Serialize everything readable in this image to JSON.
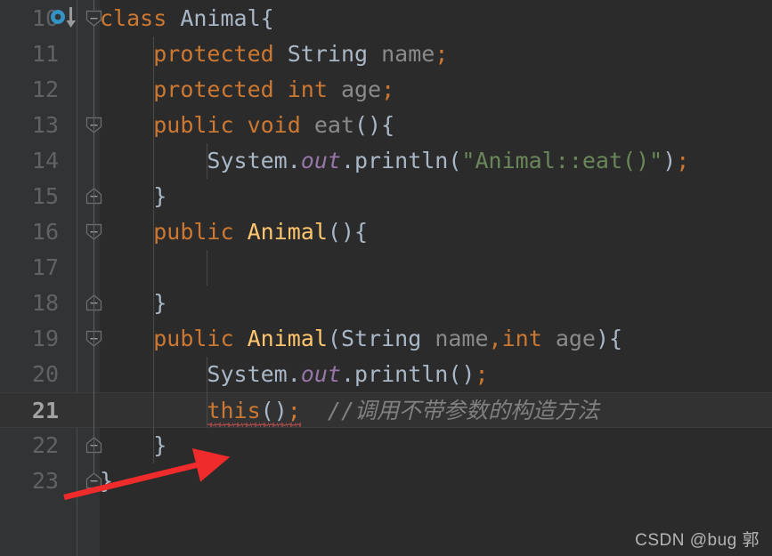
{
  "editor": {
    "theme": "darcula",
    "background": "#2b2b2b",
    "gutter_background": "#313335",
    "current_line_background": "#323232",
    "current_line_number": "21"
  },
  "colors": {
    "keyword": "#cc7832",
    "class_name": "#a9b7c6",
    "constructor_name": "#ffc66d",
    "string_literal": "#6a8759",
    "static_field": "#9876aa",
    "identifier": "#8a8a8a",
    "comment": "#808080",
    "line_number": "#606366",
    "error_squiggle": "#d25252",
    "gutter_icon_blue": "#3592c4",
    "annotation_arrow": "#ef2b2b"
  },
  "lines": [
    {
      "number": "10",
      "tokens": [
        {
          "text": "class ",
          "kind": "keyword"
        },
        {
          "text": "Animal",
          "kind": "class_name"
        },
        {
          "text": "{",
          "kind": "punc"
        }
      ]
    },
    {
      "number": "11",
      "tokens": [
        {
          "text": "    ",
          "kind": "plain"
        },
        {
          "text": "protected ",
          "kind": "keyword"
        },
        {
          "text": "String",
          "kind": "class_name"
        },
        {
          "text": " ",
          "kind": "plain"
        },
        {
          "text": "name",
          "kind": "identifier"
        },
        {
          "text": ";",
          "kind": "semi"
        }
      ]
    },
    {
      "number": "12",
      "tokens": [
        {
          "text": "    ",
          "kind": "plain"
        },
        {
          "text": "protected int ",
          "kind": "keyword"
        },
        {
          "text": "age",
          "kind": "identifier"
        },
        {
          "text": ";",
          "kind": "semi"
        }
      ]
    },
    {
      "number": "13",
      "tokens": [
        {
          "text": "    ",
          "kind": "plain"
        },
        {
          "text": "public void ",
          "kind": "keyword"
        },
        {
          "text": "eat",
          "kind": "identifier"
        },
        {
          "text": "(){",
          "kind": "punc"
        }
      ]
    },
    {
      "number": "14",
      "tokens": [
        {
          "text": "        ",
          "kind": "plain"
        },
        {
          "text": "System",
          "kind": "class_name"
        },
        {
          "text": ".",
          "kind": "punc"
        },
        {
          "text": "out",
          "kind": "static_field"
        },
        {
          "text": ".println(",
          "kind": "punc"
        },
        {
          "text": "\"Animal::eat()\"",
          "kind": "string_literal"
        },
        {
          "text": ")",
          "kind": "punc"
        },
        {
          "text": ";",
          "kind": "semi"
        }
      ]
    },
    {
      "number": "15",
      "tokens": [
        {
          "text": "    }",
          "kind": "punc"
        }
      ]
    },
    {
      "number": "16",
      "tokens": [
        {
          "text": "    ",
          "kind": "plain"
        },
        {
          "text": "public ",
          "kind": "keyword"
        },
        {
          "text": "Animal",
          "kind": "constructor_name"
        },
        {
          "text": "(){",
          "kind": "punc"
        }
      ]
    },
    {
      "number": "17",
      "tokens": []
    },
    {
      "number": "18",
      "tokens": [
        {
          "text": "    }",
          "kind": "punc"
        }
      ]
    },
    {
      "number": "19",
      "tokens": [
        {
          "text": "    ",
          "kind": "plain"
        },
        {
          "text": "public ",
          "kind": "keyword"
        },
        {
          "text": "Animal",
          "kind": "constructor_name"
        },
        {
          "text": "(",
          "kind": "punc"
        },
        {
          "text": "String",
          "kind": "class_name"
        },
        {
          "text": " ",
          "kind": "plain"
        },
        {
          "text": "name",
          "kind": "identifier"
        },
        {
          "text": ",",
          "kind": "semi"
        },
        {
          "text": "int",
          "kind": "keyword"
        },
        {
          "text": " ",
          "kind": "plain"
        },
        {
          "text": "age",
          "kind": "identifier"
        },
        {
          "text": "){",
          "kind": "punc"
        }
      ]
    },
    {
      "number": "20",
      "tokens": [
        {
          "text": "        ",
          "kind": "plain"
        },
        {
          "text": "System",
          "kind": "class_name"
        },
        {
          "text": ".",
          "kind": "punc"
        },
        {
          "text": "out",
          "kind": "static_field"
        },
        {
          "text": ".println()",
          "kind": "punc"
        },
        {
          "text": ";",
          "kind": "semi"
        }
      ]
    },
    {
      "number": "21",
      "current": true,
      "tokens": [
        {
          "text": "        ",
          "kind": "plain"
        },
        {
          "text": "this",
          "kind": "keyword",
          "error": true
        },
        {
          "text": "()",
          "kind": "punc",
          "error": true
        },
        {
          "text": ";",
          "kind": "semi",
          "error": true
        },
        {
          "text": "  ",
          "kind": "plain"
        },
        {
          "text": "//调用不带参数的构造方法",
          "kind": "comment"
        }
      ]
    },
    {
      "number": "22",
      "tokens": [
        {
          "text": "    }",
          "kind": "punc"
        }
      ]
    },
    {
      "number": "23",
      "tokens": [
        {
          "text": "}",
          "kind": "punc"
        }
      ]
    }
  ],
  "gutter_icons": [
    {
      "line": "10",
      "name": "implementation-marker-icon",
      "glyph": "blue-ring-with-down-arrow"
    }
  ],
  "fold_markers": [
    {
      "line": "10",
      "state": "expanded-open"
    },
    {
      "line": "13",
      "state": "expanded-open"
    },
    {
      "line": "15",
      "state": "expanded-close"
    },
    {
      "line": "16",
      "state": "expanded-open"
    },
    {
      "line": "18",
      "state": "expanded-close"
    },
    {
      "line": "19",
      "state": "expanded-open"
    },
    {
      "line": "22",
      "state": "expanded-close"
    },
    {
      "line": "23",
      "state": "expanded-close"
    }
  ],
  "annotation": {
    "name": "red-arrow",
    "points_to": "this();",
    "color": "#ef2b2b"
  },
  "watermark": {
    "text": "CSDN @bug 郭"
  }
}
